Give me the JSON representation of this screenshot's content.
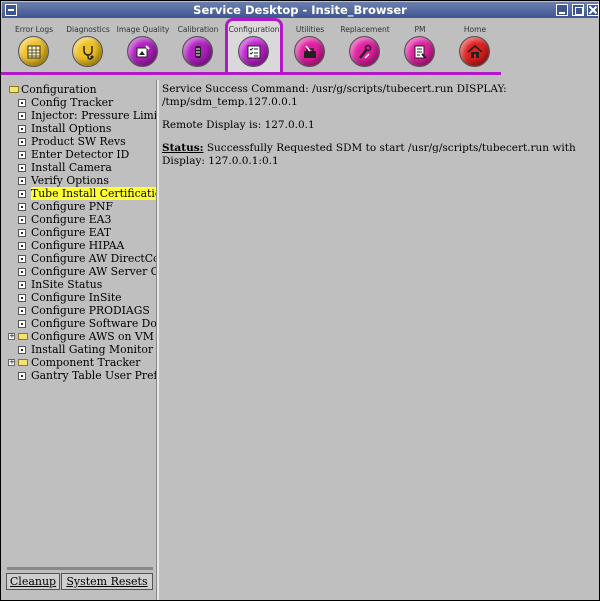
{
  "window": {
    "title": "Service Desktop - Insite_Browser"
  },
  "toolbar": {
    "items": [
      {
        "label": "Error Logs",
        "icon": "error-logs-icon",
        "color": "#f0c020"
      },
      {
        "label": "Diagnostics",
        "icon": "stethoscope-icon",
        "color": "#f0c020"
      },
      {
        "label": "Image Quality",
        "icon": "image-quality-icon",
        "color": "#b020c0"
      },
      {
        "label": "Calibration",
        "icon": "calibration-icon",
        "color": "#b020c0"
      },
      {
        "label": "Configuration",
        "icon": "checklist-icon",
        "color": "#c020d0"
      },
      {
        "label": "Utilities",
        "icon": "toolbox-icon",
        "color": "#e020a0"
      },
      {
        "label": "Replacement",
        "icon": "wrench-icon",
        "color": "#e020a0"
      },
      {
        "label": "PM",
        "icon": "pm-icon",
        "color": "#e020a0"
      },
      {
        "label": "Home",
        "icon": "home-icon",
        "color": "#e02020"
      }
    ],
    "active": "Configuration",
    "accent": "#b019c5"
  },
  "tree": {
    "root": "Configuration",
    "items": [
      {
        "label": "Config Tracker"
      },
      {
        "label": "Injector: Pressure Limit Uni"
      },
      {
        "label": "Install Options"
      },
      {
        "label": "Product SW Revs"
      },
      {
        "label": "Enter Detector ID"
      },
      {
        "label": "Install Camera"
      },
      {
        "label": "Verify Options"
      },
      {
        "label": "Tube Install Certification"
      },
      {
        "label": "Configure PNF"
      },
      {
        "label": "Configure EA3"
      },
      {
        "label": "Configure EAT"
      },
      {
        "label": "Configure HIPAA"
      },
      {
        "label": "Configure AW DirectConnec"
      },
      {
        "label": "Configure AW Server Client"
      },
      {
        "label": "InSite Status"
      },
      {
        "label": "Configure InSite"
      },
      {
        "label": "Configure PRODIAGS"
      },
      {
        "label": "Configure Software Downlo"
      },
      {
        "label": "Configure AWS on VM"
      },
      {
        "label": "Install Gating Monitor"
      },
      {
        "label": "Component Tracker"
      },
      {
        "label": "Gantry Table User Preferen"
      }
    ],
    "selected": "Tube Install Certification",
    "highlight_color": "#ffff33"
  },
  "buttons": {
    "cleanup": "Cleanup",
    "system_resets": "System Resets"
  },
  "content": {
    "line1": "Service Success Command: /usr/g/scripts/tubecert.run DISPLAY: /tmp/sdm_temp.127.0.0.1",
    "line2": "Remote Display is: 127.0.0.1",
    "status_label": "Status:",
    "status_text": " Successfully Requested SDM to start /usr/g/scripts/tubecert.run with Display: 127.0.0.1:0.1"
  }
}
